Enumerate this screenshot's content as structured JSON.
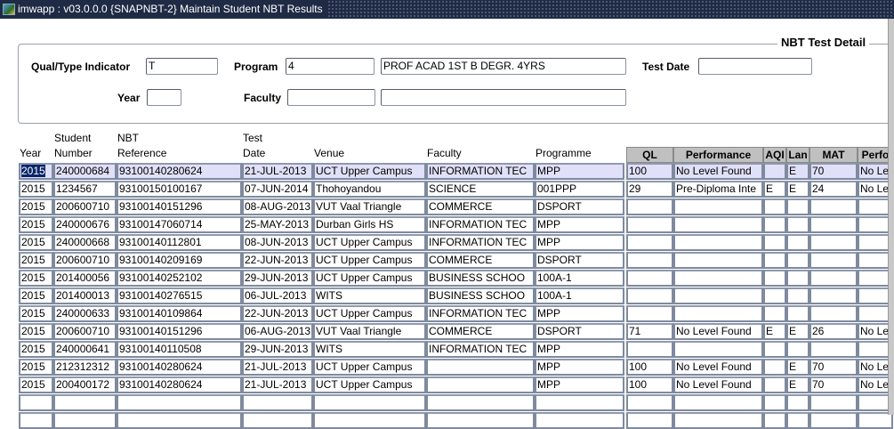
{
  "window": {
    "title": "imwapp : v03.0.0.0  {SNAPNBT-2} Maintain Student NBT Results"
  },
  "form": {
    "section_title": "NBT Test Detail",
    "qual_label": "Qual/Type Indicator",
    "qual_value": "T",
    "program_label": "Program",
    "program_code": "4",
    "program_desc": "PROF ACAD 1ST B DEGR. 4YRS",
    "testdate_label": "Test Date",
    "testdate_value": "",
    "year_label": "Year",
    "year_value": "",
    "faculty_label": "Faculty",
    "faculty_code": "",
    "faculty_desc": ""
  },
  "table": {
    "headers": [
      {
        "l1": "",
        "l2": "Year"
      },
      {
        "l1": "Student",
        "l2": "Number"
      },
      {
        "l1": "NBT",
        "l2": "Reference"
      },
      {
        "l1": "Test",
        "l2": "Date"
      },
      {
        "l1": "",
        "l2": "Venue"
      },
      {
        "l1": "",
        "l2": "Faculty"
      },
      {
        "l1": "",
        "l2": "Programme"
      }
    ],
    "score_headers": [
      "QL",
      "Performance",
      "AQI",
      "Lan",
      "MAT",
      "Perfo"
    ],
    "rows": [
      [
        "2015",
        "240000684",
        "93100140280624",
        "21-JUL-2013",
        "UCT Upper Campus",
        "INFORMATION TEC",
        "MPP",
        "100",
        "No Level Found",
        "",
        "E",
        "70",
        "No Le"
      ],
      [
        "2015",
        "1234567",
        "93100150100167",
        "07-JUN-2014",
        "Thohoyandou",
        "SCIENCE",
        "001PPP",
        "29",
        "Pre-Diploma Inte",
        "E",
        "E",
        "24",
        "No Le"
      ],
      [
        "2015",
        "200600710",
        "93100140151296",
        "08-AUG-2013",
        "VUT  Vaal Triangle",
        "COMMERCE",
        "DSPORT",
        "",
        "",
        "",
        "",
        "",
        ""
      ],
      [
        "2015",
        "240000676",
        "93100147060714",
        "25-MAY-2013",
        "Durban Girls HS",
        "INFORMATION TEC",
        "MPP",
        "",
        "",
        "",
        "",
        "",
        ""
      ],
      [
        "2015",
        "240000668",
        "93100140112801",
        "08-JUN-2013",
        "UCT Upper Campus",
        "INFORMATION TEC",
        "MPP",
        "",
        "",
        "",
        "",
        "",
        ""
      ],
      [
        "2015",
        "200600710",
        "93100140209169",
        "22-JUN-2013",
        "UCT Upper Campus",
        "COMMERCE",
        "DSPORT",
        "",
        "",
        "",
        "",
        "",
        ""
      ],
      [
        "2015",
        "201400056",
        "93100140252102",
        "29-JUN-2013",
        "UCT Upper Campus",
        "BUSINESS SCHOO",
        "100A-1",
        "",
        "",
        "",
        "",
        "",
        ""
      ],
      [
        "2015",
        "201400013",
        "93100140276515",
        "06-JUL-2013",
        "WITS",
        "BUSINESS SCHOO",
        "100A-1",
        "",
        "",
        "",
        "",
        "",
        ""
      ],
      [
        "2015",
        "240000633",
        "93100140109864",
        "22-JUN-2013",
        "UCT Upper Campus",
        "INFORMATION TEC",
        "MPP",
        "",
        "",
        "",
        "",
        "",
        ""
      ],
      [
        "2015",
        "200600710",
        "93100140151296",
        "06-AUG-2013",
        "VUT  Vaal Triangle",
        "COMMERCE",
        "DSPORT",
        "71",
        "No Level Found",
        "E",
        "E",
        "26",
        "No Le"
      ],
      [
        "2015",
        "240000641",
        "93100140110508",
        "29-JUN-2013",
        "WITS",
        "INFORMATION TEC",
        "MPP",
        "",
        "",
        "",
        "",
        "",
        ""
      ],
      [
        "2015",
        "212312312",
        "93100140280624",
        "21-JUL-2013",
        "UCT Upper Campus",
        "",
        "MPP",
        "100",
        "No Level Found",
        "",
        "E",
        "70",
        "No Le"
      ],
      [
        "2015",
        "200400172",
        "93100140280624",
        "21-JUL-2013",
        "UCT Upper Campus",
        "",
        "MPP",
        "100",
        "No Level Found",
        "",
        "E",
        "70",
        "No Le"
      ],
      [
        "",
        "",
        "",
        "",
        "",
        "",
        "",
        "",
        "",
        "",
        "",
        "",
        ""
      ],
      [
        "",
        "",
        "",
        "",
        "",
        "",
        "",
        "",
        "",
        "",
        "",
        "",
        ""
      ]
    ]
  }
}
